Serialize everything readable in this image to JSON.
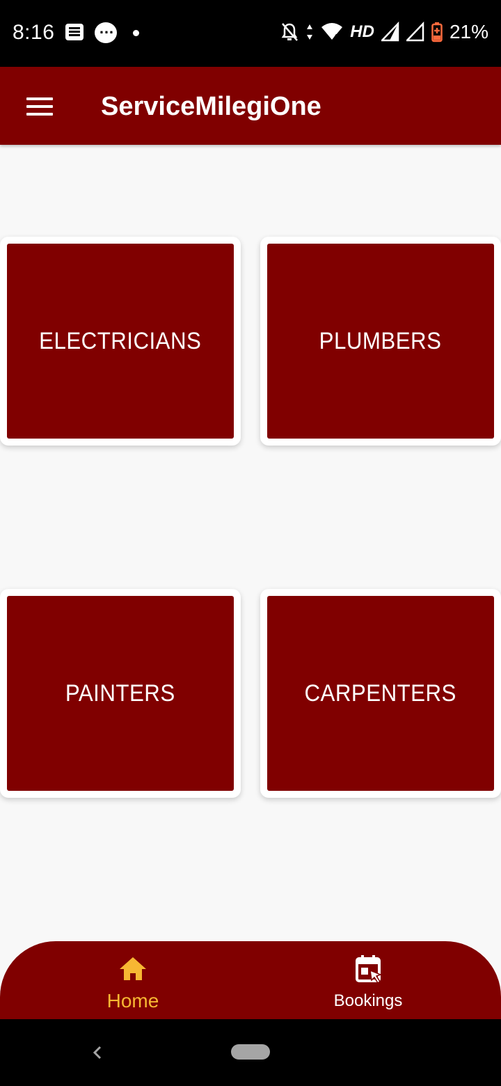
{
  "status_bar": {
    "time": "8:16",
    "network_label": "HD",
    "battery_percent": "21%",
    "icons": [
      "message-icon",
      "chat-bubble-icon",
      "notification-dot-icon",
      "notifications-off-icon",
      "data-arrows-icon",
      "wifi-icon",
      "signal-icon",
      "signal-icon",
      "battery-charging-icon"
    ]
  },
  "app_bar": {
    "title": "ServiceMilegiOne",
    "menu_icon": "hamburger-menu-icon"
  },
  "services": [
    {
      "label": "ELECTRICIANS"
    },
    {
      "label": "PLUMBERS"
    },
    {
      "label": "PAINTERS"
    },
    {
      "label": "CARPENTERS"
    }
  ],
  "bottom_nav": {
    "items": [
      {
        "label": "Home",
        "icon": "home-icon",
        "active": true
      },
      {
        "label": "Bookings",
        "icon": "calendar-booking-icon",
        "active": false
      }
    ]
  },
  "colors": {
    "primary": "#800000",
    "active_nav": "#f7b733",
    "background": "#f8f8f8"
  }
}
